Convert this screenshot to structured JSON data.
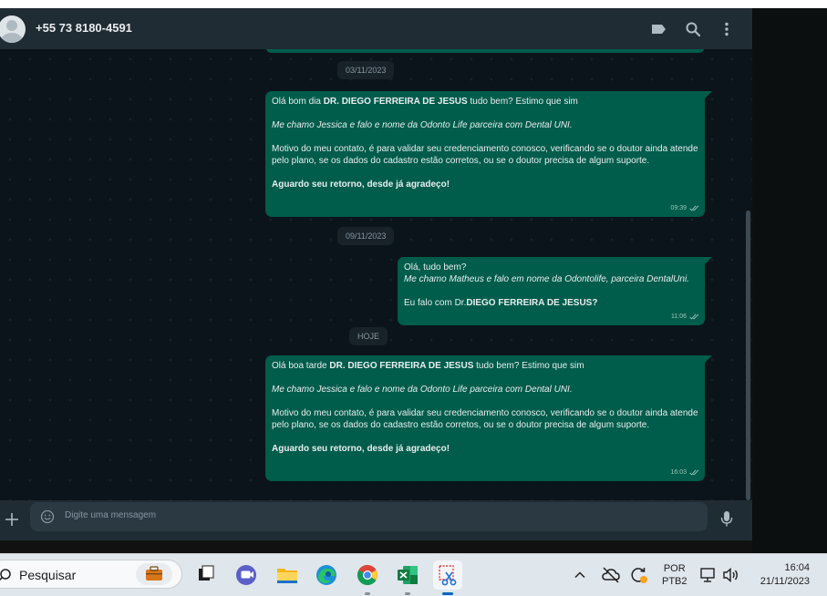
{
  "header": {
    "contact_name": "+55 73 8180-4591",
    "icons": [
      "label-icon",
      "search-icon",
      "menu-icon"
    ]
  },
  "chat": {
    "dates": [
      "03/11/2023",
      "09/11/2023",
      "HOJE"
    ],
    "messages": [
      {
        "line1_pre": "Olá bom dia ",
        "line1_bold": "DR. DIEGO FERREIRA DE JESUS",
        "line1_post": " tudo bem? Estimo que sim",
        "italic": "Me chamo Jessica e falo e nome da Odonto Life parceira com Dental UNI.",
        "para": "Motivo do meu contato, é para validar seu credenciamento conosco, verificando se o doutor ainda atende pelo plano, se os dados do cadastro estão corretos, ou se o doutor precisa de algum suporte.",
        "closing": "Aguardo seu retorno, desde já agradeço!",
        "time": "09:39"
      },
      {
        "line1": "Olá, tudo bem?",
        "italic": "Me chamo Matheus e falo em nome da Odontolife, parceira DentalUni.",
        "line3_pre": "Eu falo com Dr.",
        "line3_bold": "DIEGO FERREIRA DE JESUS?",
        "time": "11:06"
      },
      {
        "line1_pre": "Olá boa tarde ",
        "line1_bold": "DR. DIEGO FERREIRA DE JESUS",
        "line1_post": " tudo bem? Estimo que sim",
        "italic": "Me chamo Jessica e falo e nome da Odonto Life parceira com Dental UNI.",
        "para": "Motivo do meu contato, é para validar seu credenciamento conosco, verificando se o doutor ainda atende pelo plano, se os dados do cadastro estão corretos, ou se o doutor precisa de algum suporte.",
        "closing": "Aguardo seu retorno, desde já agradeço!",
        "time": "16:03"
      }
    ]
  },
  "composer": {
    "placeholder": "Digite uma mensagem"
  },
  "taskbar": {
    "search_label": "Pesquisar",
    "apps": [
      "briefcase-icon",
      "task-view-icon",
      "teams-icon",
      "file-explorer-icon",
      "edge-icon",
      "chrome-icon",
      "excel-icon",
      "snipping-tool-icon"
    ],
    "language": "POR",
    "keyboard": "PTB2",
    "time": "16:04",
    "date": "21/11/2023"
  },
  "colors": {
    "outgoing_bubble": "#005c4b",
    "header": "#202c33",
    "chat_bg": "#0b141a",
    "taskbar": "#dfe6ec"
  }
}
